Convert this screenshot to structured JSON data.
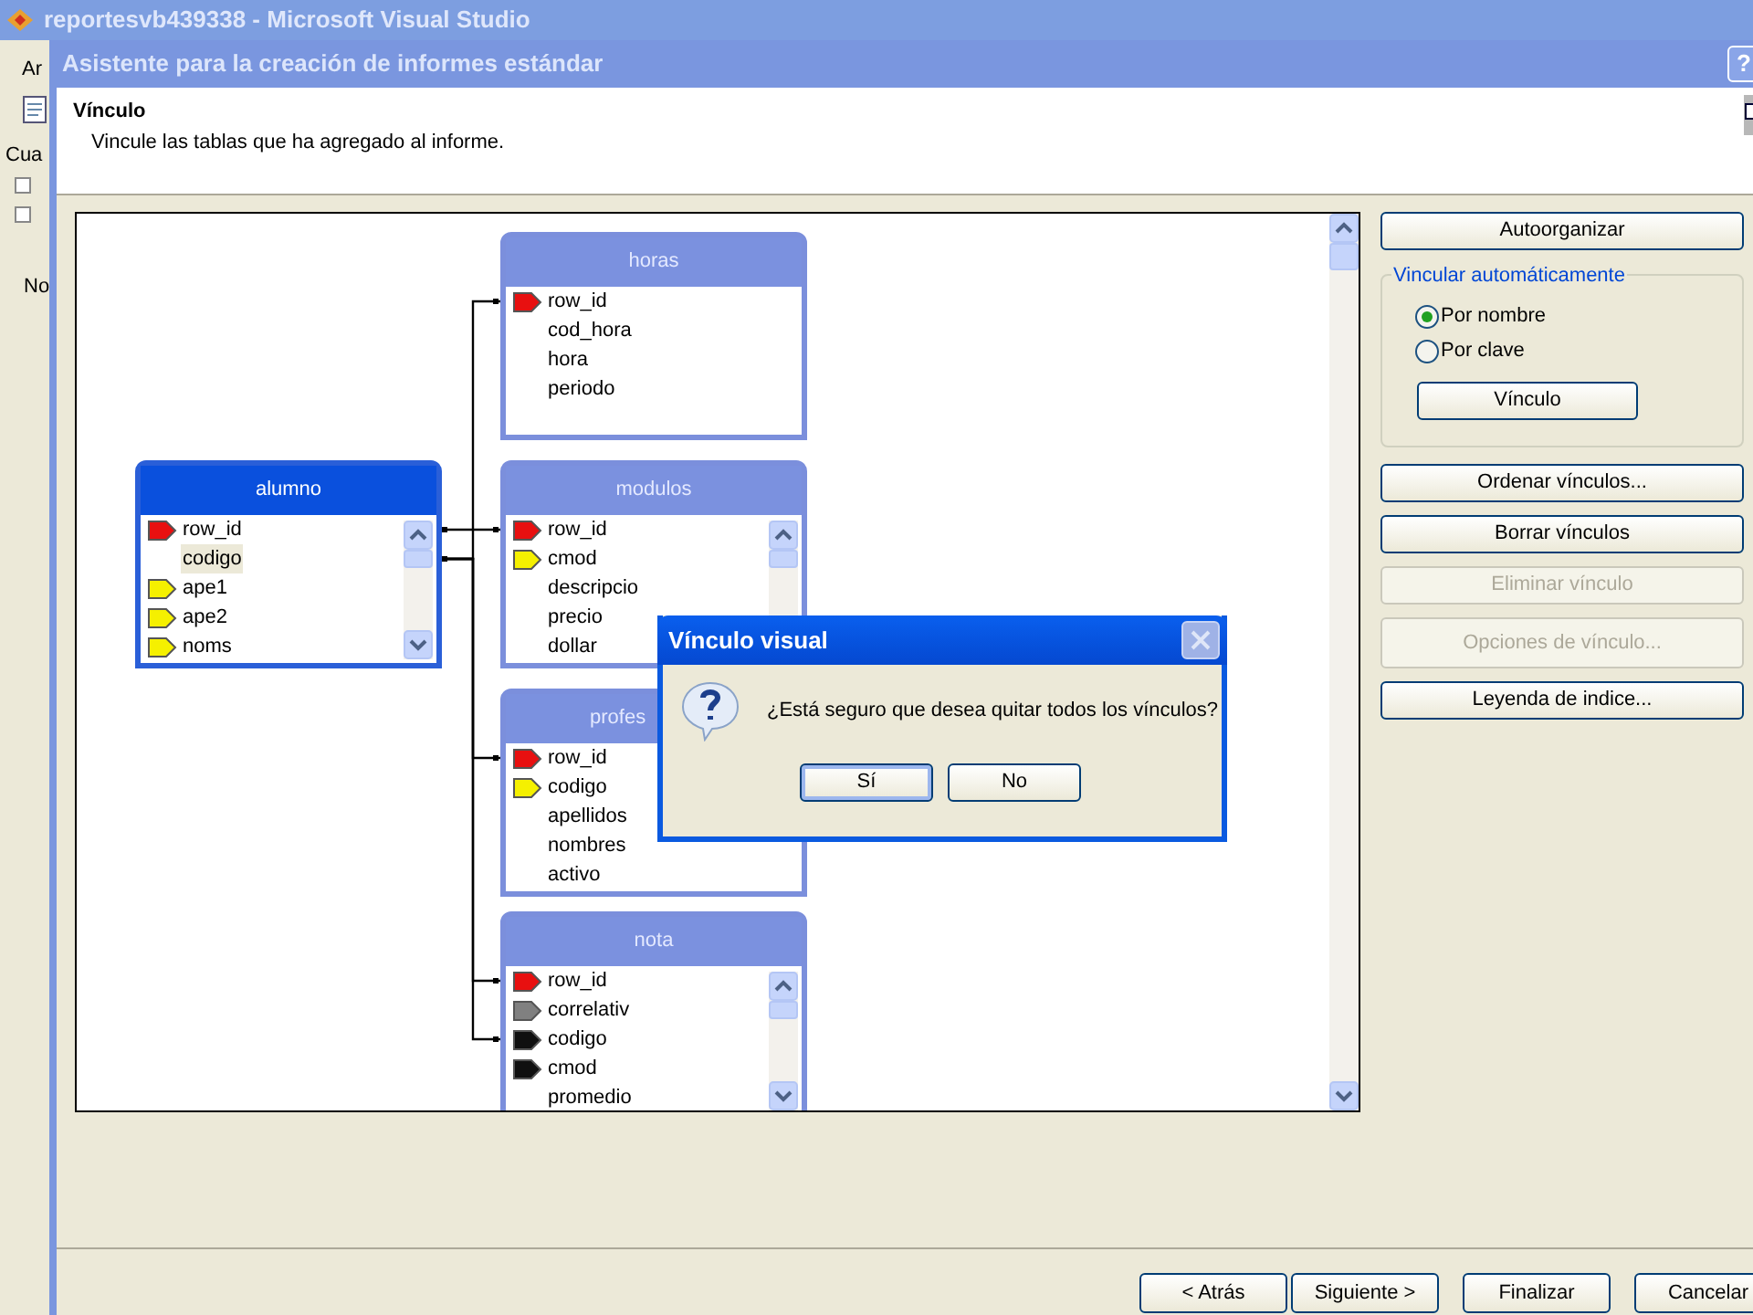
{
  "main_window": {
    "title": "reportesvb439338 - Microsoft Visual Studio",
    "menu_fragment": "Ar",
    "panel_fragment": "Cua",
    "tree_fragment": "No"
  },
  "wizard": {
    "title": "Asistente para la creación de informes estándar",
    "help_button": "?",
    "heading": "Vínculo",
    "subheading": "Vincule las tablas que ha agregado al informe.",
    "tables": [
      {
        "name": "horas",
        "active": false,
        "has_scrollbar": false,
        "fields": [
          {
            "name": "row_id",
            "color": "#e81010",
            "selected": false,
            "linked": true
          },
          {
            "name": "cod_hora",
            "selected": false
          },
          {
            "name": "hora",
            "selected": false
          },
          {
            "name": "periodo",
            "selected": false
          }
        ]
      },
      {
        "name": "alumno",
        "active": true,
        "has_scrollbar": true,
        "source": true,
        "fields": [
          {
            "name": "row_id",
            "color": "#e81010",
            "selected": false,
            "linked": true
          },
          {
            "name": "codigo",
            "selected": true,
            "linked": true
          },
          {
            "name": "ape1",
            "color": "#f5f000",
            "selected": false
          },
          {
            "name": "ape2",
            "color": "#f5f000",
            "selected": false
          },
          {
            "name": "noms",
            "color": "#f5f000",
            "selected": false
          }
        ]
      },
      {
        "name": "modulos",
        "active": false,
        "has_scrollbar": true,
        "fields": [
          {
            "name": "row_id",
            "color": "#e81010",
            "selected": false,
            "linked": true
          },
          {
            "name": "cmod",
            "color": "#f5f000",
            "selected": false
          },
          {
            "name": "descripcio",
            "selected": false
          },
          {
            "name": "precio",
            "selected": false
          },
          {
            "name": "dollar",
            "selected": false
          }
        ]
      },
      {
        "name": "profes",
        "active": false,
        "has_scrollbar": false,
        "fields": [
          {
            "name": "row_id",
            "color": "#e81010",
            "selected": false,
            "linked": true
          },
          {
            "name": "codigo",
            "color": "#f5f000",
            "selected": false
          },
          {
            "name": "apellidos",
            "selected": false
          },
          {
            "name": "nombres",
            "selected": false
          },
          {
            "name": "activo",
            "selected": false
          }
        ]
      },
      {
        "name": "nota",
        "active": false,
        "has_scrollbar": true,
        "fields": [
          {
            "name": "row_id",
            "color": "#e81010",
            "selected": false,
            "linked": true
          },
          {
            "name": "correlativ",
            "color": "#808080",
            "selected": false
          },
          {
            "name": "codigo",
            "color": "#101010",
            "selected": false,
            "linked": true
          },
          {
            "name": "cmod",
            "color": "#101010",
            "selected": false
          },
          {
            "name": "promedio",
            "selected": false
          }
        ]
      }
    ],
    "side_buttons": [
      {
        "label": "Autoorganizar",
        "disabled": false
      }
    ],
    "auto_link": {
      "legend": "Vincular automáticamente",
      "options": [
        {
          "label": "Por nombre",
          "selected": true
        },
        {
          "label": "Por clave",
          "selected": false
        }
      ],
      "button": "Vínculo"
    },
    "more_buttons": [
      {
        "label": "Ordenar vínculos...",
        "disabled": false
      },
      {
        "label": "Borrar vínculos",
        "disabled": false
      },
      {
        "label": "Eliminar vínculo",
        "disabled": true
      },
      {
        "label": "Opciones de vínculo...",
        "disabled": true
      },
      {
        "label": "Leyenda de indice...",
        "disabled": false
      }
    ],
    "footer_buttons": [
      {
        "label": "< Atrás"
      },
      {
        "label": "Siguiente >"
      },
      {
        "label": "Finalizar"
      },
      {
        "label": "Cancelar"
      }
    ]
  },
  "message_box": {
    "title": "Vínculo visual",
    "message": "¿Está seguro que desea quitar todos los vínculos?",
    "buttons": [
      {
        "label": "Sí",
        "focused": true
      },
      {
        "label": "No",
        "focused": false
      }
    ]
  }
}
